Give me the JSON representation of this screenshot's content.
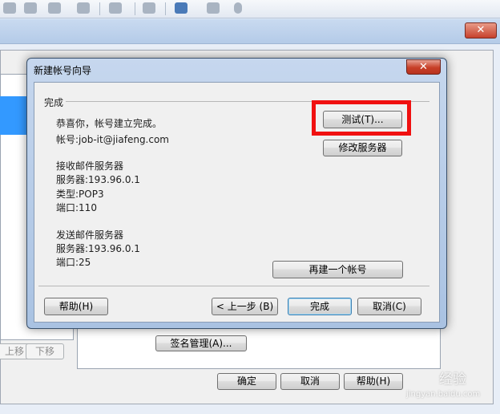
{
  "dialog": {
    "title": "新建帐号向导",
    "close_label": "✕",
    "section_label": "完成",
    "congrats": "恭喜你，帐号建立完成。",
    "account": "帐号:job-it@jiafeng.com",
    "incoming": {
      "heading": "接收邮件服务器",
      "server": "服务器:193.96.0.1",
      "type": "类型:POP3",
      "port": "端口:110"
    },
    "outgoing": {
      "heading": "发送邮件服务器",
      "server": "服务器:193.96.0.1",
      "port": "端口:25"
    },
    "buttons": {
      "test": "测试(T)...",
      "modify_server": "修改服务器",
      "new_account": "再建一个帐号",
      "help": "帮助(H)",
      "back": "< 上一步 (B)",
      "finish": "完成",
      "cancel": "取消(C)"
    }
  },
  "background": {
    "move_up": "上移",
    "move_down": "下移",
    "signature_manage": "签名管理(A)...",
    "ok": "确定",
    "cancel": "取消",
    "help": "帮助(H)"
  },
  "watermark": {
    "brand": "经验",
    "url": "jingyan.baidu.com"
  },
  "colors": {
    "highlight": "#f01010",
    "dialog_frame": "#a9c2e2"
  }
}
